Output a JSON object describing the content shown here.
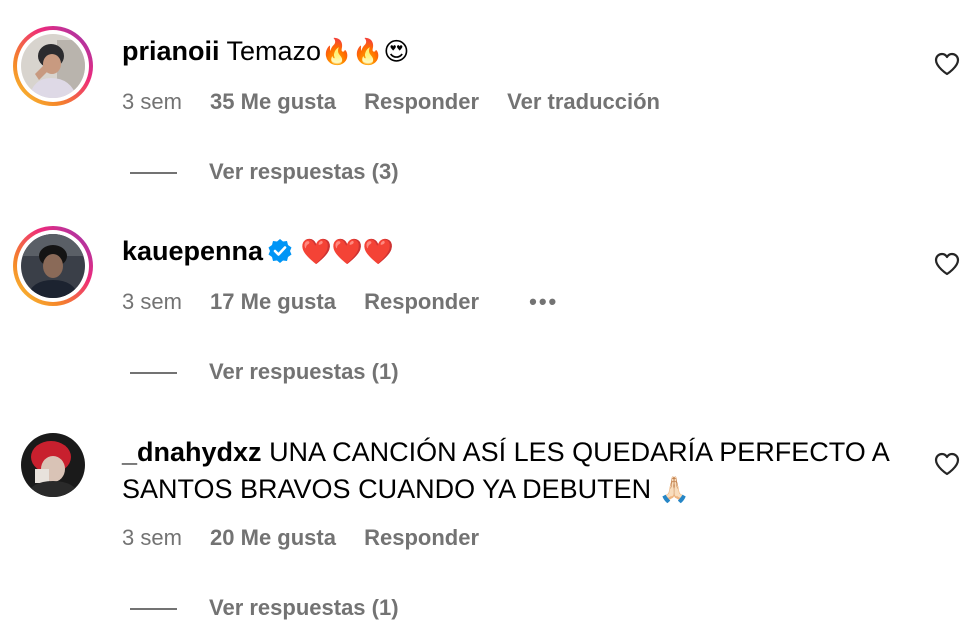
{
  "comments": [
    {
      "username": "prianoii",
      "text": "Temazo",
      "emojis": "🔥🔥😍",
      "time": "3 sem",
      "likes": "35 Me gusta",
      "reply_label": "Responder",
      "translate_label": "Ver traducción",
      "view_replies": "Ver respuestas (3)"
    },
    {
      "username": "kauepenna",
      "verified": true,
      "text": "",
      "emojis": "❤️❤️❤️",
      "time": "3 sem",
      "likes": "17 Me gusta",
      "reply_label": "Responder",
      "more_label": "•••",
      "view_replies": "Ver respuestas (1)"
    },
    {
      "username": "_dnahydxz",
      "text": "UNA CANCIÓN ASÍ LES QUEDARÍA PERFECTO A SANTOS BRAVOS CUANDO YA DEBUTEN",
      "emojis": "🙏🏻",
      "time": "3 sem",
      "likes": "20 Me gusta",
      "reply_label": "Responder",
      "view_replies": "Ver respuestas (1)"
    }
  ],
  "colors": {
    "text": "#000000",
    "secondary": "#737373",
    "verified": "#0095f6",
    "ring_start": "#f9ce34",
    "ring_end": "#8a3ab9"
  },
  "icons": {
    "like": "heart-outline-icon",
    "verified": "verified-badge-icon",
    "more": "more-options-icon"
  }
}
